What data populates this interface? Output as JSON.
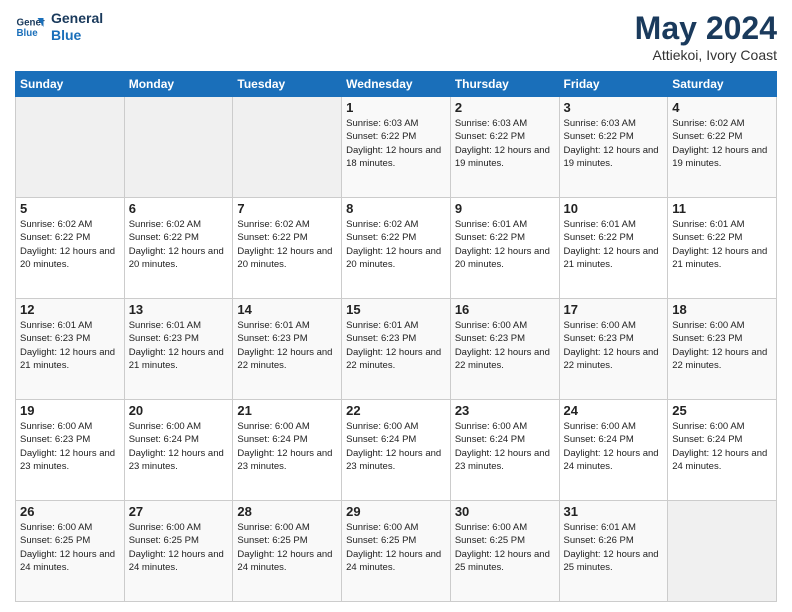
{
  "header": {
    "logo_line1": "General",
    "logo_line2": "Blue",
    "title": "May 2024",
    "subtitle": "Attiekoi, Ivory Coast"
  },
  "days_of_week": [
    "Sunday",
    "Monday",
    "Tuesday",
    "Wednesday",
    "Thursday",
    "Friday",
    "Saturday"
  ],
  "weeks": [
    [
      {
        "day": "",
        "info": ""
      },
      {
        "day": "",
        "info": ""
      },
      {
        "day": "",
        "info": ""
      },
      {
        "day": "1",
        "info": "Sunrise: 6:03 AM\nSunset: 6:22 PM\nDaylight: 12 hours\nand 18 minutes."
      },
      {
        "day": "2",
        "info": "Sunrise: 6:03 AM\nSunset: 6:22 PM\nDaylight: 12 hours\nand 19 minutes."
      },
      {
        "day": "3",
        "info": "Sunrise: 6:03 AM\nSunset: 6:22 PM\nDaylight: 12 hours\nand 19 minutes."
      },
      {
        "day": "4",
        "info": "Sunrise: 6:02 AM\nSunset: 6:22 PM\nDaylight: 12 hours\nand 19 minutes."
      }
    ],
    [
      {
        "day": "5",
        "info": "Sunrise: 6:02 AM\nSunset: 6:22 PM\nDaylight: 12 hours\nand 20 minutes."
      },
      {
        "day": "6",
        "info": "Sunrise: 6:02 AM\nSunset: 6:22 PM\nDaylight: 12 hours\nand 20 minutes."
      },
      {
        "day": "7",
        "info": "Sunrise: 6:02 AM\nSunset: 6:22 PM\nDaylight: 12 hours\nand 20 minutes."
      },
      {
        "day": "8",
        "info": "Sunrise: 6:02 AM\nSunset: 6:22 PM\nDaylight: 12 hours\nand 20 minutes."
      },
      {
        "day": "9",
        "info": "Sunrise: 6:01 AM\nSunset: 6:22 PM\nDaylight: 12 hours\nand 20 minutes."
      },
      {
        "day": "10",
        "info": "Sunrise: 6:01 AM\nSunset: 6:22 PM\nDaylight: 12 hours\nand 21 minutes."
      },
      {
        "day": "11",
        "info": "Sunrise: 6:01 AM\nSunset: 6:22 PM\nDaylight: 12 hours\nand 21 minutes."
      }
    ],
    [
      {
        "day": "12",
        "info": "Sunrise: 6:01 AM\nSunset: 6:23 PM\nDaylight: 12 hours\nand 21 minutes."
      },
      {
        "day": "13",
        "info": "Sunrise: 6:01 AM\nSunset: 6:23 PM\nDaylight: 12 hours\nand 21 minutes."
      },
      {
        "day": "14",
        "info": "Sunrise: 6:01 AM\nSunset: 6:23 PM\nDaylight: 12 hours\nand 22 minutes."
      },
      {
        "day": "15",
        "info": "Sunrise: 6:01 AM\nSunset: 6:23 PM\nDaylight: 12 hours\nand 22 minutes."
      },
      {
        "day": "16",
        "info": "Sunrise: 6:00 AM\nSunset: 6:23 PM\nDaylight: 12 hours\nand 22 minutes."
      },
      {
        "day": "17",
        "info": "Sunrise: 6:00 AM\nSunset: 6:23 PM\nDaylight: 12 hours\nand 22 minutes."
      },
      {
        "day": "18",
        "info": "Sunrise: 6:00 AM\nSunset: 6:23 PM\nDaylight: 12 hours\nand 22 minutes."
      }
    ],
    [
      {
        "day": "19",
        "info": "Sunrise: 6:00 AM\nSunset: 6:23 PM\nDaylight: 12 hours\nand 23 minutes."
      },
      {
        "day": "20",
        "info": "Sunrise: 6:00 AM\nSunset: 6:24 PM\nDaylight: 12 hours\nand 23 minutes."
      },
      {
        "day": "21",
        "info": "Sunrise: 6:00 AM\nSunset: 6:24 PM\nDaylight: 12 hours\nand 23 minutes."
      },
      {
        "day": "22",
        "info": "Sunrise: 6:00 AM\nSunset: 6:24 PM\nDaylight: 12 hours\nand 23 minutes."
      },
      {
        "day": "23",
        "info": "Sunrise: 6:00 AM\nSunset: 6:24 PM\nDaylight: 12 hours\nand 23 minutes."
      },
      {
        "day": "24",
        "info": "Sunrise: 6:00 AM\nSunset: 6:24 PM\nDaylight: 12 hours\nand 24 minutes."
      },
      {
        "day": "25",
        "info": "Sunrise: 6:00 AM\nSunset: 6:24 PM\nDaylight: 12 hours\nand 24 minutes."
      }
    ],
    [
      {
        "day": "26",
        "info": "Sunrise: 6:00 AM\nSunset: 6:25 PM\nDaylight: 12 hours\nand 24 minutes."
      },
      {
        "day": "27",
        "info": "Sunrise: 6:00 AM\nSunset: 6:25 PM\nDaylight: 12 hours\nand 24 minutes."
      },
      {
        "day": "28",
        "info": "Sunrise: 6:00 AM\nSunset: 6:25 PM\nDaylight: 12 hours\nand 24 minutes."
      },
      {
        "day": "29",
        "info": "Sunrise: 6:00 AM\nSunset: 6:25 PM\nDaylight: 12 hours\nand 24 minutes."
      },
      {
        "day": "30",
        "info": "Sunrise: 6:00 AM\nSunset: 6:25 PM\nDaylight: 12 hours\nand 25 minutes."
      },
      {
        "day": "31",
        "info": "Sunrise: 6:01 AM\nSunset: 6:26 PM\nDaylight: 12 hours\nand 25 minutes."
      },
      {
        "day": "",
        "info": ""
      }
    ]
  ]
}
